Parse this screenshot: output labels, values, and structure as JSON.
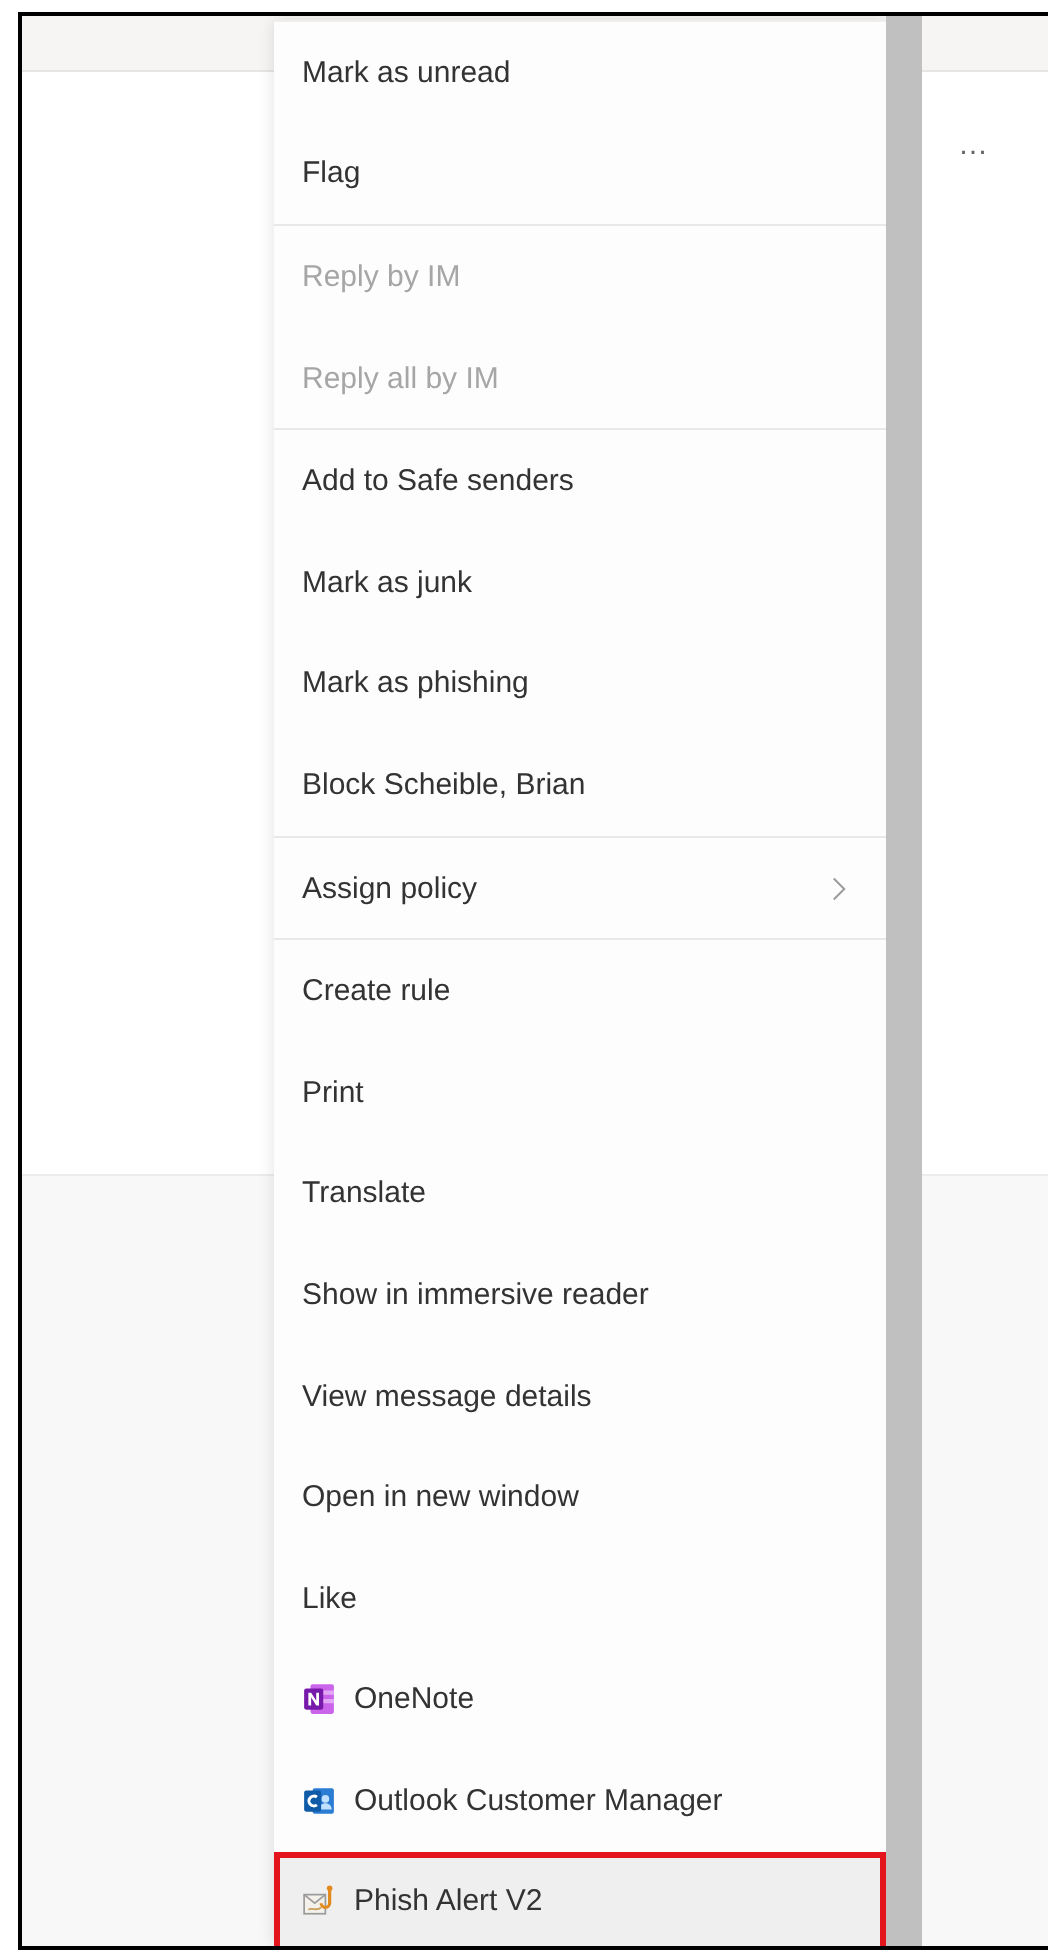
{
  "background": {
    "more_button": "…"
  },
  "menu": {
    "groups": [
      {
        "items": [
          {
            "label": "Mark as unread",
            "kind": "plain",
            "disabled": false,
            "selected": false
          },
          {
            "label": "Flag",
            "kind": "plain",
            "disabled": false,
            "selected": false
          }
        ]
      },
      {
        "items": [
          {
            "label": "Reply by IM",
            "kind": "plain",
            "disabled": true,
            "selected": false
          },
          {
            "label": "Reply all by IM",
            "kind": "plain",
            "disabled": true,
            "selected": false
          }
        ]
      },
      {
        "items": [
          {
            "label": "Add to Safe senders",
            "kind": "plain",
            "disabled": false,
            "selected": false
          },
          {
            "label": "Mark as junk",
            "kind": "plain",
            "disabled": false,
            "selected": false
          },
          {
            "label": "Mark as phishing",
            "kind": "plain",
            "disabled": false,
            "selected": false
          },
          {
            "label": "Block Scheible, Brian",
            "kind": "plain",
            "disabled": false,
            "selected": false
          }
        ]
      },
      {
        "items": [
          {
            "label": "Assign policy",
            "kind": "submenu",
            "disabled": false,
            "selected": false
          }
        ]
      },
      {
        "items": [
          {
            "label": "Create rule",
            "kind": "plain",
            "disabled": false,
            "selected": false
          },
          {
            "label": "Print",
            "kind": "plain",
            "disabled": false,
            "selected": false
          },
          {
            "label": "Translate",
            "kind": "plain",
            "disabled": false,
            "selected": false
          },
          {
            "label": "Show in immersive reader",
            "kind": "plain",
            "disabled": false,
            "selected": false
          },
          {
            "label": "View message details",
            "kind": "plain",
            "disabled": false,
            "selected": false
          },
          {
            "label": "Open in new window",
            "kind": "plain",
            "disabled": false,
            "selected": false
          },
          {
            "label": "Like",
            "kind": "plain",
            "disabled": false,
            "selected": false
          },
          {
            "label": "OneNote",
            "kind": "app",
            "disabled": false,
            "selected": false
          },
          {
            "label": "Outlook Customer Manager",
            "kind": "app",
            "disabled": false,
            "selected": false
          },
          {
            "label": "Phish Alert V2",
            "kind": "app",
            "disabled": false,
            "selected": true
          }
        ]
      }
    ]
  }
}
